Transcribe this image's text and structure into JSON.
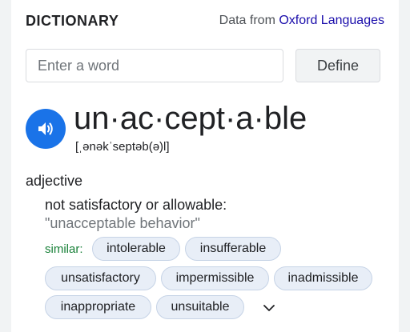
{
  "header": {
    "title": "DICTIONARY",
    "source_prefix": "Data from ",
    "source_link": "Oxford Languages"
  },
  "search": {
    "placeholder": "Enter a word",
    "value": "",
    "button_label": "Define"
  },
  "entry": {
    "audio_icon": "speaker-icon",
    "headword": "un·ac·cept·a·ble",
    "phonetic": "[ˌənəkˈseptəb(ə)l]",
    "part_of_speech": "adjective",
    "definition": "not satisfactory or allowable:",
    "example": "\"unacceptable behavior\"",
    "similar_label": "similar:",
    "similar_words": [
      "intolerable",
      "insufferable",
      "unsatisfactory",
      "impermissible",
      "inadmissible",
      "inappropriate",
      "unsuitable"
    ],
    "expand_icon": "chevron-down-icon"
  },
  "colors": {
    "accent": "#1a73e8",
    "link": "#1a0dab",
    "similar_label": "#188038",
    "chip_bg": "#e8eef7"
  }
}
